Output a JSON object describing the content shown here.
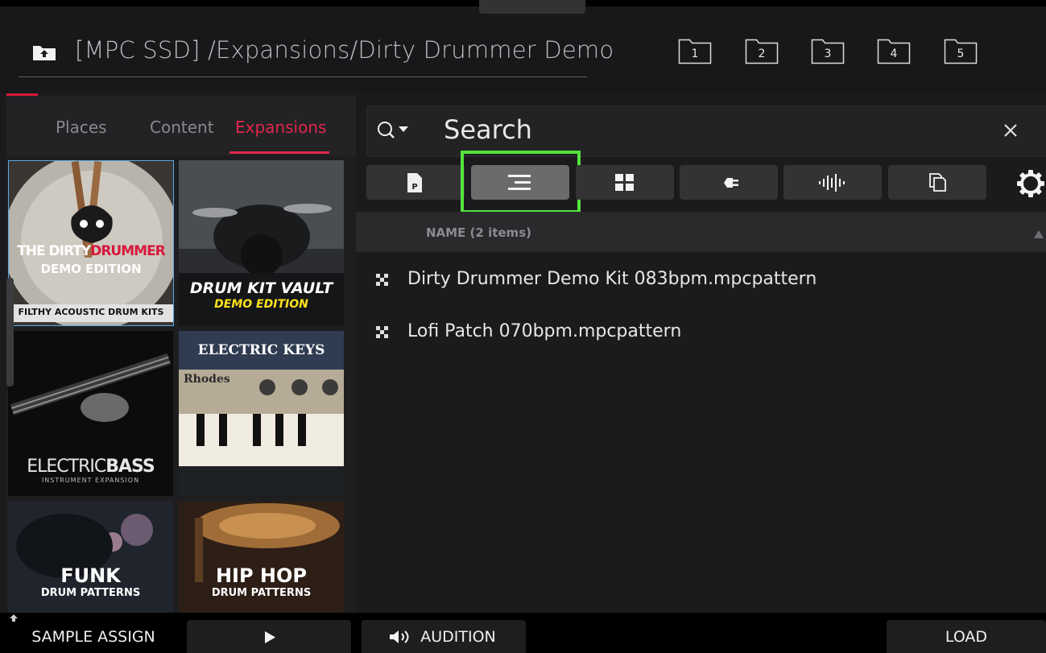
{
  "header": {
    "path": "[MPC SSD] /Expansions/Dirty Drummer Demo",
    "favorites": [
      "1",
      "2",
      "3",
      "4",
      "5"
    ]
  },
  "left_tabs": [
    "Places",
    "Content",
    "Expansions"
  ],
  "thumbnails": [
    {
      "line1": "THE DIRTY",
      "line1b": "DRUMMER",
      "line2": "DEMO EDITION",
      "line3": "FILTHY ACOUSTIC DRUM KITS"
    },
    {
      "line1": "DRUM KIT VAULT",
      "line2": "DEMO EDITION"
    },
    {
      "line1": "ELECTRIC",
      "line1b": "BASS",
      "line2": "INSTRUMENT EXPANSION"
    },
    {
      "line1": "ELECTRIC KEYS",
      "line2": "Rhodes"
    },
    {
      "line1": "FUNK",
      "line2": "DRUM PATTERNS"
    },
    {
      "line1": "HIP HOP",
      "line2": "DRUM PATTERNS"
    }
  ],
  "search": {
    "value": "Search"
  },
  "list": {
    "header": "NAME (2 items)",
    "items": [
      "Dirty Drummer Demo Kit 083bpm.mpcpattern",
      "Lofi Patch 070bpm.mpcpattern"
    ]
  },
  "bottom": {
    "sample_assign": "SAMPLE ASSIGN",
    "play_icon": "play-icon",
    "audition": "AUDITION",
    "load": "LOAD"
  },
  "colors": {
    "accent": "#e0264d",
    "highlight": "#55e33c"
  }
}
